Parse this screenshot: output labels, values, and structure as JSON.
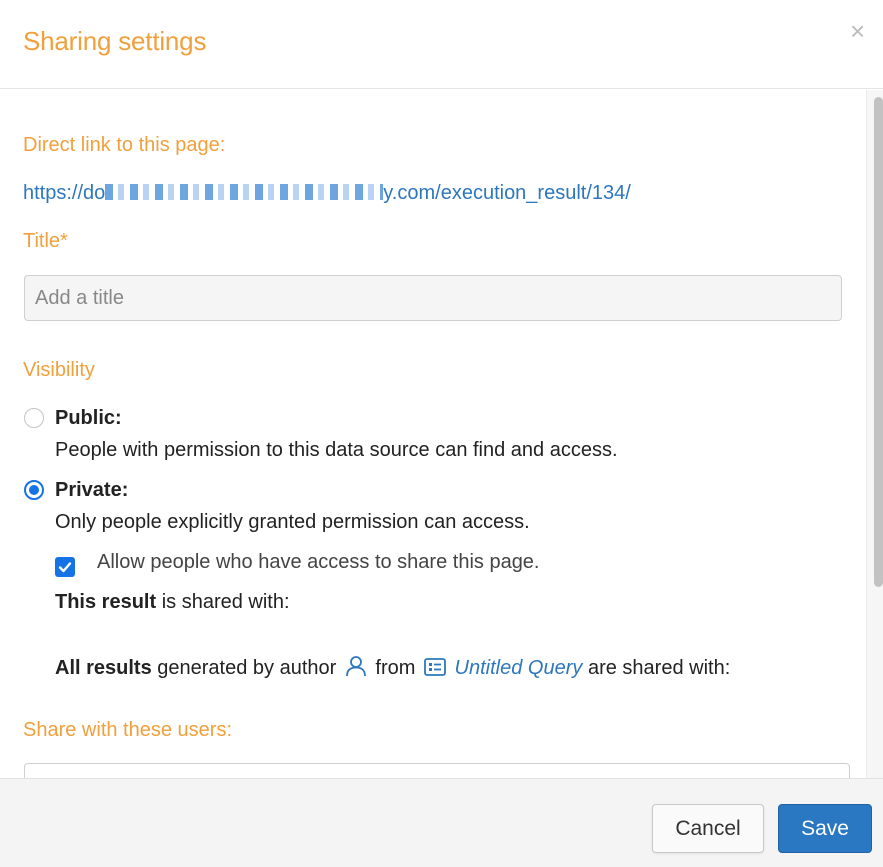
{
  "dialog": {
    "title": "Sharing settings",
    "close_symbol": "×"
  },
  "direct_link": {
    "label": "Direct link to this page:",
    "prefix": "https://do",
    "suffix": "y.com/execution_result/134/"
  },
  "title_field": {
    "label": "Title*",
    "placeholder": "Add a title",
    "value": ""
  },
  "visibility": {
    "label": "Visibility",
    "options": [
      {
        "title": "Public:",
        "description": "People with permission to this data source can find and access.",
        "selected": false
      },
      {
        "title": "Private:",
        "description": "Only people explicitly granted permission can access.",
        "selected": true
      }
    ],
    "allow_share": {
      "label": "Allow people who have access to share this page.",
      "checked": true
    },
    "result_shared": {
      "bold": "This result",
      "rest": "is shared with:"
    },
    "all_results": {
      "bold": "All results",
      "text1": "generated by author",
      "text2": "from",
      "query_name": "Untitled Query",
      "text3": "are shared with:"
    }
  },
  "share_users": {
    "label": "Share with these users:"
  },
  "footer": {
    "cancel_label": "Cancel",
    "save_label": "Save"
  },
  "colors": {
    "accent": "#f0a03c",
    "link": "#2d77be",
    "primary": "#2a77c2",
    "radio": "#1673e5"
  },
  "icons": {
    "author": "user-icon",
    "query": "query-icon",
    "close": "close-icon"
  }
}
